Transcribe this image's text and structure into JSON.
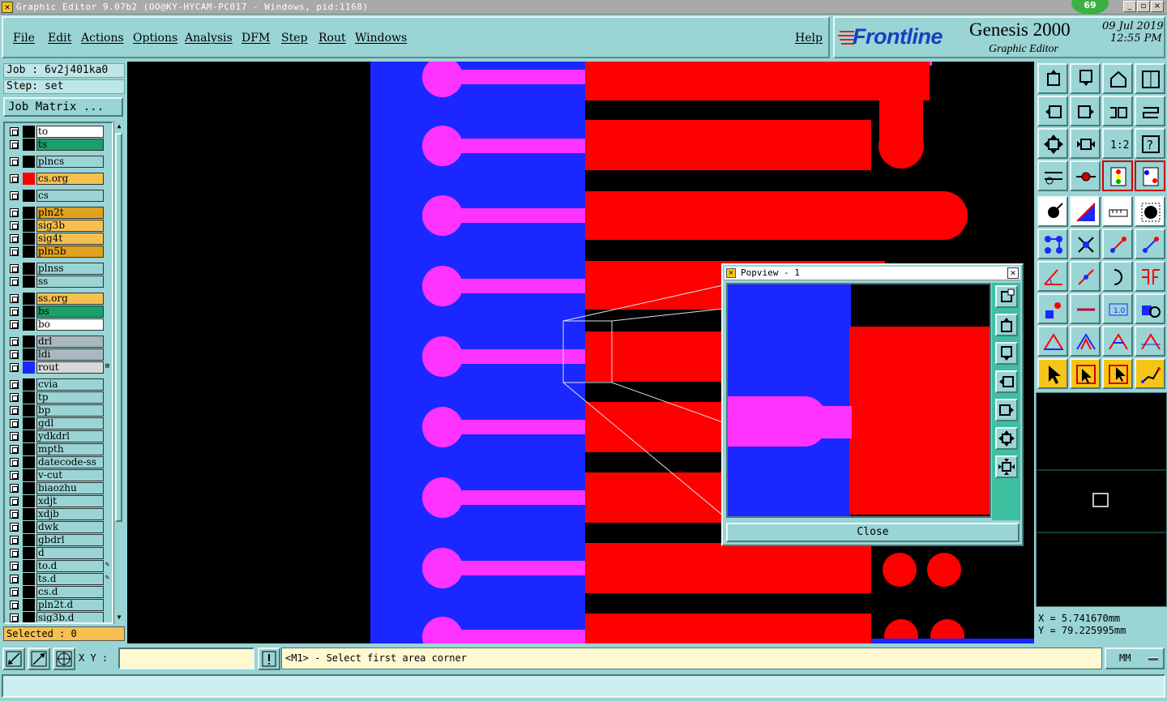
{
  "window": {
    "title": "Graphic Editor 9.07b2 (OO@KY-HYCAM-PC017 - Windows, pid:1168)",
    "badge": "69",
    "controls": [
      "_",
      "▫",
      "×"
    ]
  },
  "menu": {
    "items": [
      "File",
      "Edit",
      "Actions",
      "Options",
      "Analysis",
      "DFM",
      "Step",
      "Rout",
      "Windows"
    ],
    "help": "Help"
  },
  "brand": {
    "logo": "Frontline",
    "product": "Genesis 2000",
    "subtitle": "Graphic Editor",
    "date": "09 Jul 2019",
    "time": "12:55 PM"
  },
  "job": {
    "job_label": "Job : 6v2j401ka0",
    "step_label": "Step: set",
    "matrix_button": "Job Matrix ..."
  },
  "layers": [
    {
      "name": "to",
      "color": "#ffffff",
      "swatch": "#000000"
    },
    {
      "name": "ts",
      "color": "#1aa06a",
      "swatch": "#000000"
    },
    {
      "name": "plncs",
      "color": "#9ad4d4",
      "swatch": "#000000"
    },
    {
      "name": "cs.org",
      "color": "#f5c050",
      "swatch": "#ff0000"
    },
    {
      "name": "cs",
      "color": "#9ad4d4",
      "swatch": "#000000"
    },
    {
      "name": "pln2t",
      "color": "#e0a020",
      "swatch": "#000000"
    },
    {
      "name": "sig3b",
      "color": "#f5c050",
      "swatch": "#000000"
    },
    {
      "name": "sig4t",
      "color": "#f5c050",
      "swatch": "#000000"
    },
    {
      "name": "pln5b",
      "color": "#e0a020",
      "swatch": "#000000"
    },
    {
      "name": "plnss",
      "color": "#9ad4d4",
      "swatch": "#000000"
    },
    {
      "name": "ss",
      "color": "#9ad4d4",
      "swatch": "#000000"
    },
    {
      "name": "ss.org",
      "color": "#f5c050",
      "swatch": "#000000"
    },
    {
      "name": "bs",
      "color": "#1aa06a",
      "swatch": "#000000"
    },
    {
      "name": "bo",
      "color": "#ffffff",
      "swatch": "#000000"
    },
    {
      "name": "drl",
      "color": "#a8b8c0",
      "swatch": "#000000"
    },
    {
      "name": "ldi",
      "color": "#a8b8c0",
      "swatch": "#000000"
    },
    {
      "name": "rout",
      "color": "#d8d8d8",
      "swatch": "#1a28ff",
      "mark": "⊞"
    },
    {
      "name": "cvia",
      "color": "#9ad4d4",
      "swatch": "#000000"
    },
    {
      "name": "tp",
      "color": "#9ad4d4",
      "swatch": "#000000"
    },
    {
      "name": "bp",
      "color": "#9ad4d4",
      "swatch": "#000000"
    },
    {
      "name": "gdl",
      "color": "#9ad4d4",
      "swatch": "#000000"
    },
    {
      "name": "ydkdrl",
      "color": "#9ad4d4",
      "swatch": "#000000"
    },
    {
      "name": "mpth",
      "color": "#9ad4d4",
      "swatch": "#000000"
    },
    {
      "name": "datecode-ss",
      "color": "#9ad4d4",
      "swatch": "#000000"
    },
    {
      "name": "v-cut",
      "color": "#9ad4d4",
      "swatch": "#000000"
    },
    {
      "name": "biaozhu",
      "color": "#9ad4d4",
      "swatch": "#000000"
    },
    {
      "name": "xdjt",
      "color": "#9ad4d4",
      "swatch": "#000000"
    },
    {
      "name": "xdjb",
      "color": "#9ad4d4",
      "swatch": "#000000"
    },
    {
      "name": "dwk",
      "color": "#9ad4d4",
      "swatch": "#000000"
    },
    {
      "name": "gbdrl",
      "color": "#9ad4d4",
      "swatch": "#000000"
    },
    {
      "name": "d",
      "color": "#9ad4d4",
      "swatch": "#000000"
    },
    {
      "name": "to.d",
      "color": "#9ad4d4",
      "swatch": "#000000",
      "mark": "✎"
    },
    {
      "name": "ts.d",
      "color": "#9ad4d4",
      "swatch": "#000000",
      "mark": "✎"
    },
    {
      "name": "cs.d",
      "color": "#9ad4d4",
      "swatch": "#000000"
    },
    {
      "name": "pln2t.d",
      "color": "#9ad4d4",
      "swatch": "#000000"
    },
    {
      "name": "sig3b.d",
      "color": "#9ad4d4",
      "swatch": "#000000"
    }
  ],
  "selected": "Selected : 0",
  "popview": {
    "title": "Popview - 1",
    "close_label": "Close"
  },
  "coords": {
    "x": "X  =  5.741670mm",
    "y": "Y  = 79.225995mm"
  },
  "bottom": {
    "xy_label": "X Y :",
    "xy_value": "",
    "prompt": "<M1> - Select first area corner",
    "units": "MM"
  },
  "colors": {
    "panel": "#9ad4d4",
    "blue_layer": "#1a28ff",
    "red_layer": "#ff0000",
    "magenta_layer": "#ff33ff"
  },
  "icons": {
    "toolbar": [
      "zoom-home-icon",
      "zoom-in-icon",
      "home-icon",
      "full-view-icon",
      "pan-left-icon",
      "pan-right-icon",
      "undo-view-icon",
      "redraw-icon",
      "fit-icon",
      "center-icon",
      "scale-1-2-icon",
      "help-query-icon",
      "measure-icon",
      "snap-icon",
      "layers-icon",
      "layers-icon-2",
      "select-icon",
      "line-icon",
      "ruler-icon",
      "pad-icon",
      "node-icon",
      "cross-icon",
      "connect-icon",
      "connect-icon-2",
      "angle-icon",
      "slash-icon",
      "arc-icon",
      "flip-icon",
      "point-icon",
      "minus-icon",
      "dimension-icon",
      "shapes-icon",
      "triangle-icon",
      "triangle-icon-2",
      "triangle-icon-3",
      "triangle-icon-4",
      "pointer-icon",
      "pointer-box-icon",
      "pointer-box-icon-2",
      "path-icon"
    ]
  }
}
